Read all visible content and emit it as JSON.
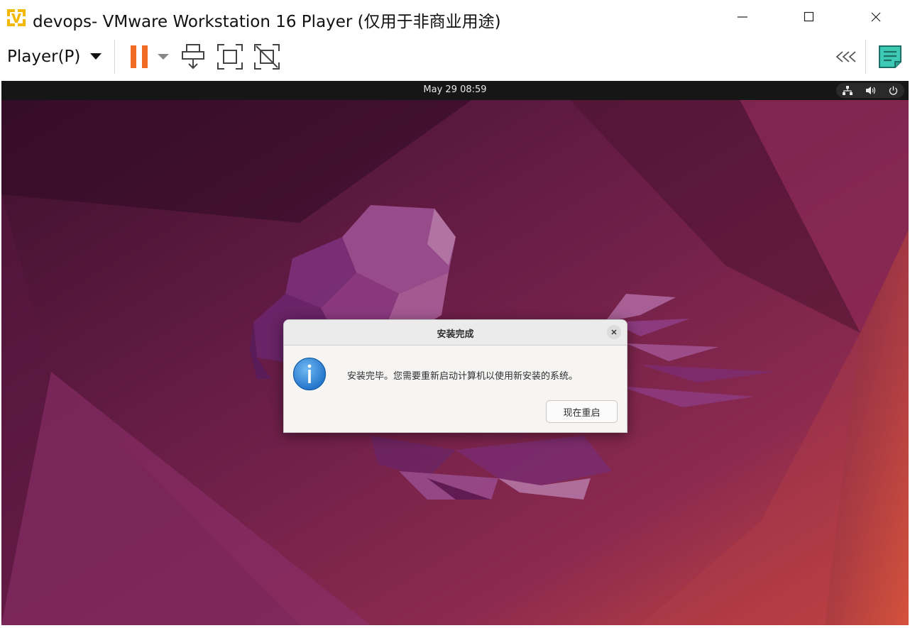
{
  "window": {
    "title": "devops- VMware Workstation 16 Player (仅用于非商业用途)",
    "controls": {
      "minimize": "minimize-icon",
      "maximize": "maximize-icon",
      "close": "close-icon"
    }
  },
  "toolbar": {
    "player_menu_label": "Player(P)",
    "icons": [
      "pause-icon",
      "dropdown-arrow-icon",
      "send-ctrl-alt-del-icon",
      "fullscreen-icon",
      "unity-icon",
      "collapse-toolbar-icon",
      "message-log-icon"
    ],
    "accent_color": "#f26b22"
  },
  "vm_screen": {
    "top_bar": {
      "clock": "May 29  08:59",
      "tray_icons": [
        "network-icon",
        "volume-icon",
        "power-icon"
      ]
    },
    "dialog": {
      "title": "安装完成",
      "message": "安装完毕。您需要重新启动计算机以使用新安装的系统。",
      "button_label": "现在重启",
      "icon": "info-icon"
    }
  }
}
